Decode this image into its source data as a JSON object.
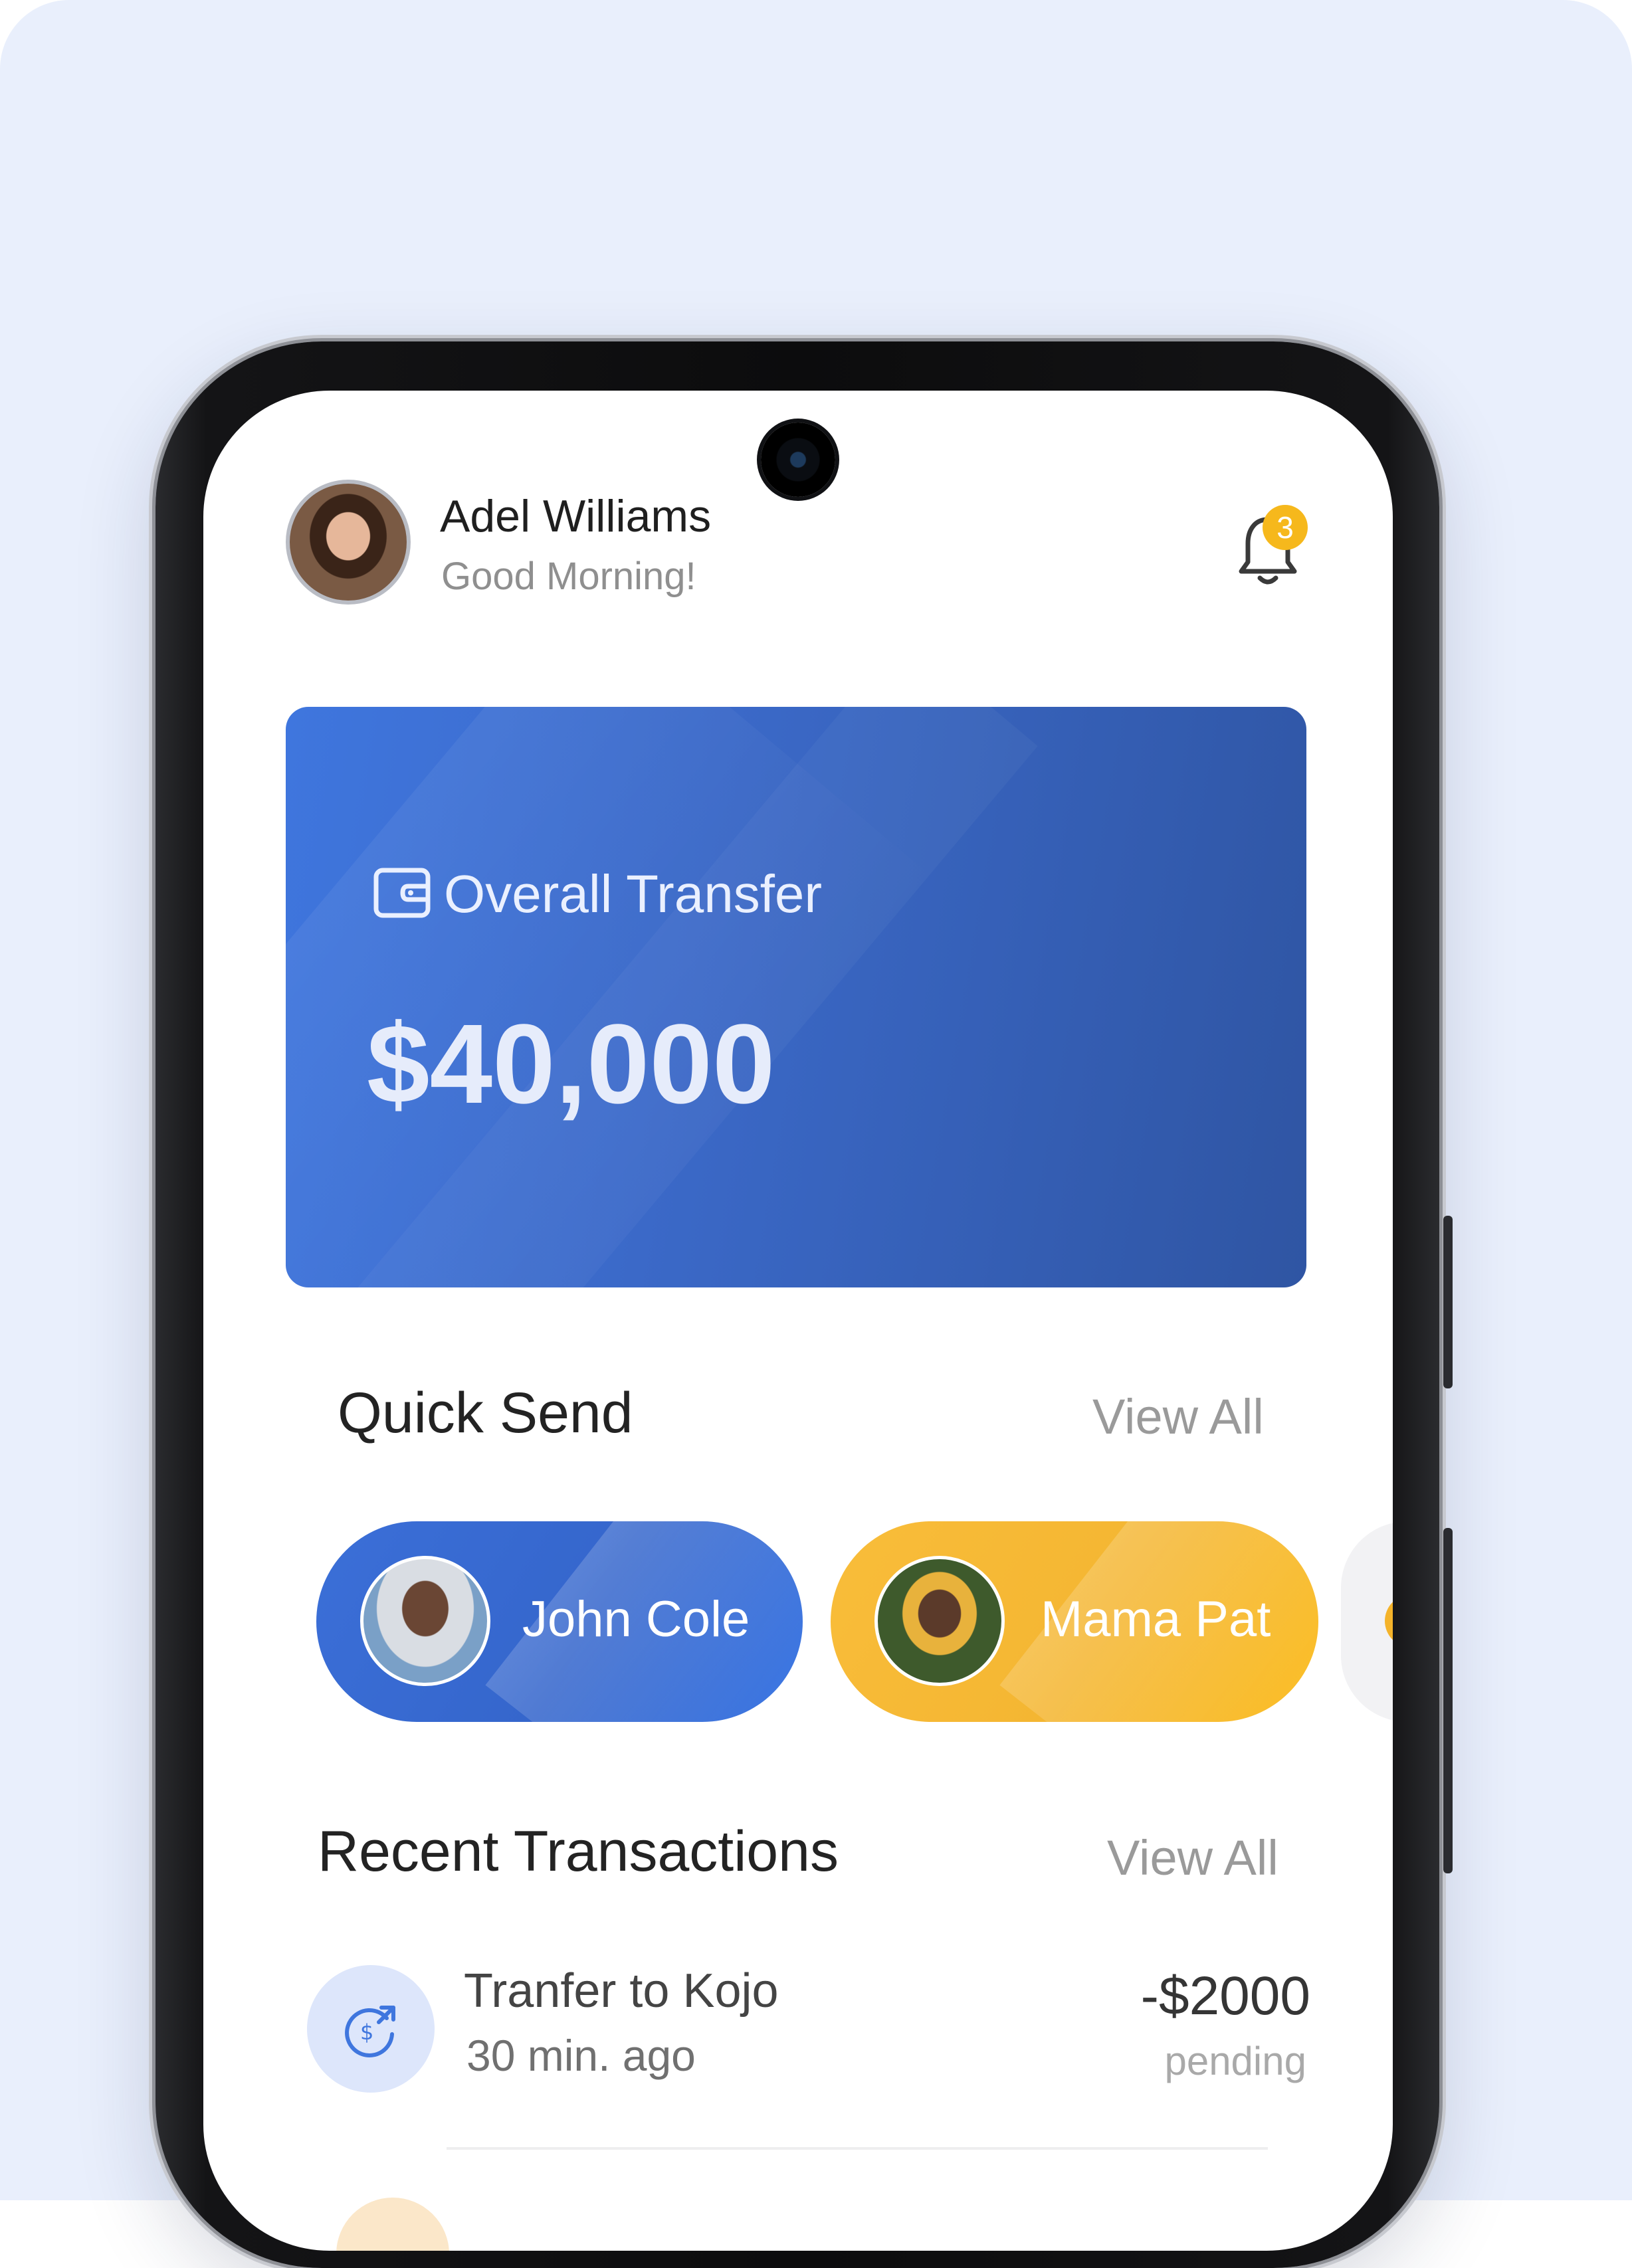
{
  "header": {
    "user_name": "Adel Williams",
    "greeting": "Good Morning!",
    "notification_count": "3"
  },
  "balance_card": {
    "label": "Overall Transfer",
    "amount": "$40,000"
  },
  "quick_send": {
    "title": "Quick Send",
    "view_all": "View All",
    "contacts": [
      {
        "name": "John Cole",
        "color": "#3b6fd8"
      },
      {
        "name": "Mama Pat",
        "color": "#f6b830"
      }
    ]
  },
  "recent_transactions": {
    "title": "Recent Transactions",
    "view_all": "View All",
    "items": [
      {
        "title": "Tranfer to Kojo",
        "time": "30 min. ago",
        "amount": "-$2000",
        "status": "pending"
      }
    ]
  },
  "colors": {
    "accent_blue": "#3f76de",
    "accent_yellow": "#f6b81c",
    "background": "#e9effc"
  },
  "icons": [
    "wallet-icon",
    "bell-icon",
    "transfer-dollar-icon"
  ]
}
